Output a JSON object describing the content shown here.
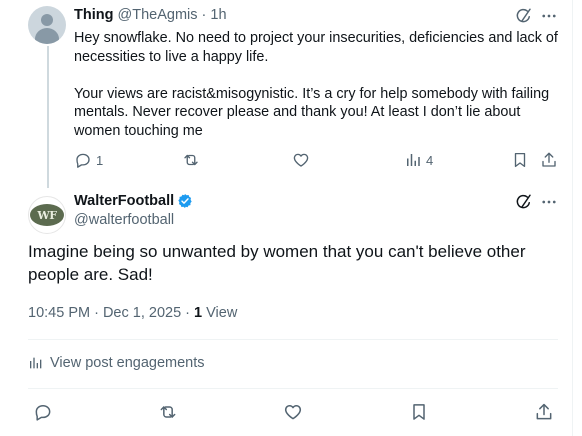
{
  "reply": {
    "display_name": "Thing",
    "handle": "@TheAgmis",
    "separator": "·",
    "time": "1h",
    "paragraph_1": "Hey snowflake. No need to project your insecurities, deficiencies and lack of necessities to live a happy life.",
    "paragraph_2": "Your views are racist&misogynistic. It’s a cry for help somebody with failing mentals. Never recover please and thank you! At least I don’t lie about women touching me",
    "reply_count": "1",
    "view_count": "4"
  },
  "main": {
    "display_name": "WalterFootball",
    "handle": "@walterfootball",
    "avatar_text": "WF",
    "text": "Imagine being so unwanted by women that you can't believe other people are. Sad!",
    "timestamp": "10:45 PM · Dec 1, 2025 · ",
    "views_count": "1",
    "views_label": " View",
    "engagements_label": "View post engagements"
  },
  "colors": {
    "text": "#0f1419",
    "muted": "#536471",
    "verified": "#1d9bf0",
    "divider": "#eff3f4"
  }
}
